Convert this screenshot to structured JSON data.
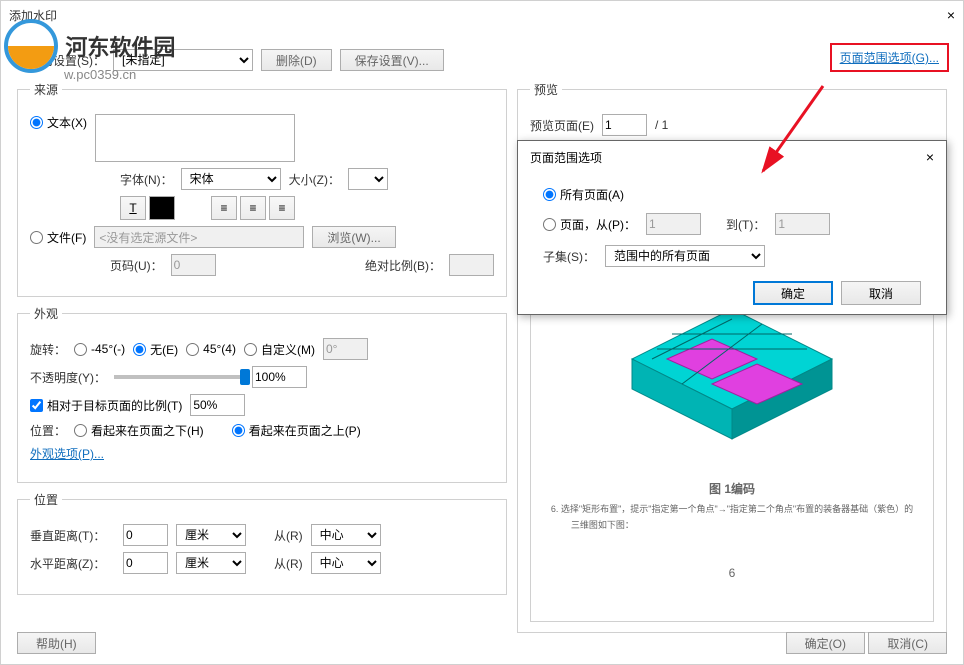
{
  "window": {
    "title": "添加水印",
    "close": "×"
  },
  "logo": {
    "text": "河东软件园",
    "url": "w.pc0359.cn"
  },
  "toolbar": {
    "saved_settings_label": "保存的设置(S)：",
    "saved_settings_value": "[未指定]",
    "delete_btn": "删除(D)",
    "save_settings_btn": "保存设置(V)...",
    "page_range_link": "页面范围选项(G)..."
  },
  "source": {
    "legend": "来源",
    "text_radio": "文本(X)",
    "font_label": "字体(N)：",
    "font_value": "宋体",
    "size_label": "大小(Z)：",
    "file_radio": "文件(F)",
    "file_placeholder": "<没有选定源文件>",
    "browse_btn": "浏览(W)...",
    "page_label": "页码(U)：",
    "page_value": "0",
    "scale_label": "绝对比例(B)："
  },
  "appearance": {
    "legend": "外观",
    "rotation_label": "旋转：",
    "rot_neg45": "-45°(-)",
    "rot_none": "无(E)",
    "rot_45": "45°(4)",
    "rot_custom": "自定义(M)",
    "rot_value": "0°",
    "opacity_label": "不透明度(Y)：",
    "opacity_value": "100%",
    "relative_scale_check": "相对于目标页面的比例(T)",
    "relative_scale_value": "50%",
    "position_label": "位置：",
    "behind": "看起来在页面之下(H)",
    "above": "看起来在页面之上(P)",
    "appearance_link": "外观选项(P)..."
  },
  "position": {
    "legend": "位置",
    "vdist_label": "垂直距离(T)：",
    "vdist_value": "0",
    "vdist_unit": "厘米",
    "vfrom_label": "从(R)",
    "vfrom_value": "中心",
    "hdist_label": "水平距离(Z)：",
    "hdist_value": "0",
    "hdist_unit": "厘米",
    "hfrom_label": "从(R)",
    "hfrom_value": "中心"
  },
  "preview": {
    "legend": "预览",
    "page_label": "预览页面(E)",
    "page_value": "1",
    "page_total": "/ 1",
    "caption": "图 1编码",
    "desc1": "6. 选择\"矩形布置\"，提示\"指定第一个角点\"→\"指定第二个角点\"布置的装备器基础（紫色）的",
    "desc2": "三维图如下图：",
    "num": "6"
  },
  "popup": {
    "title": "页面范围选项",
    "close": "×",
    "all_pages": "所有页面(A)",
    "pages_from": "页面，从(P)：",
    "from_value": "1",
    "to_label": "到(T)：",
    "to_value": "1",
    "subset_label": "子集(S)：",
    "subset_value": "范围中的所有页面",
    "ok": "确定",
    "cancel": "取消"
  },
  "footer": {
    "help": "帮助(H)",
    "ok": "确定(O)",
    "cancel": "取消(C)"
  }
}
